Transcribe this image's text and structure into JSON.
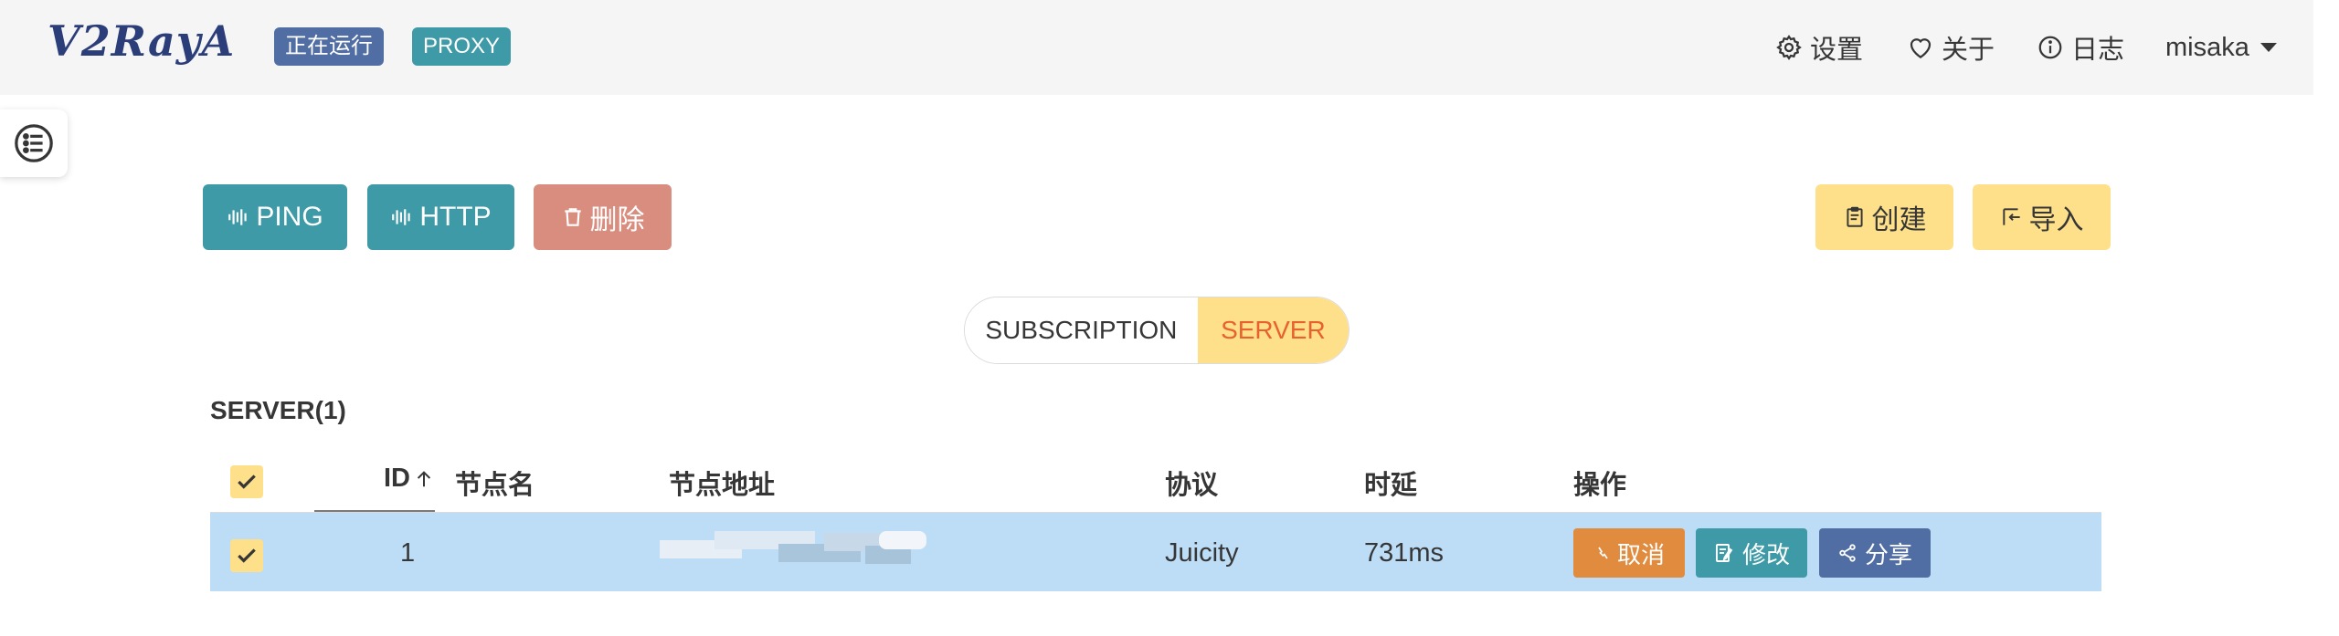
{
  "navbar": {
    "logo": "V2RayA",
    "status_tag": "正在运行",
    "mode_tag": "PROXY",
    "settings": "设置",
    "about": "关于",
    "log": "日志",
    "user": "misaka"
  },
  "toolbar": {
    "ping": "PING",
    "http": "HTTP",
    "delete": "删除",
    "create": "创建",
    "import": "导入"
  },
  "tabs": {
    "subscription": "SUBSCRIPTION",
    "server": "SERVER",
    "active": "SERVER"
  },
  "section_title": "SERVER(1)",
  "table": {
    "headers": {
      "id": "ID",
      "name": "节点名",
      "address": "节点地址",
      "protocol": "协议",
      "latency": "时延",
      "operations": "操作"
    },
    "rows": [
      {
        "selected": true,
        "id": "1",
        "name": "",
        "protocol": "Juicity",
        "latency": "731ms",
        "actions": {
          "cancel": "取消",
          "edit": "修改",
          "share": "分享"
        }
      }
    ]
  },
  "icons": {
    "settings": "gear-icon",
    "about": "heart-icon",
    "log": "info-icon",
    "user_menu": "caret-down-icon",
    "float_menu": "list-icon",
    "ping": "wave-icon",
    "http": "wave-icon",
    "delete": "trash-icon",
    "create": "clipboard-icon",
    "import": "import-icon",
    "cancel": "link-icon",
    "edit": "edit-icon",
    "share": "share-icon"
  },
  "colors": {
    "teal": "#3e9aa6",
    "navy": "#506da4",
    "salmon": "#d98d7f",
    "yellow": "#ffe08a",
    "orange": "#e08b3e",
    "row_selected": "#bdddf7",
    "server_tab_text": "#e8622e"
  }
}
